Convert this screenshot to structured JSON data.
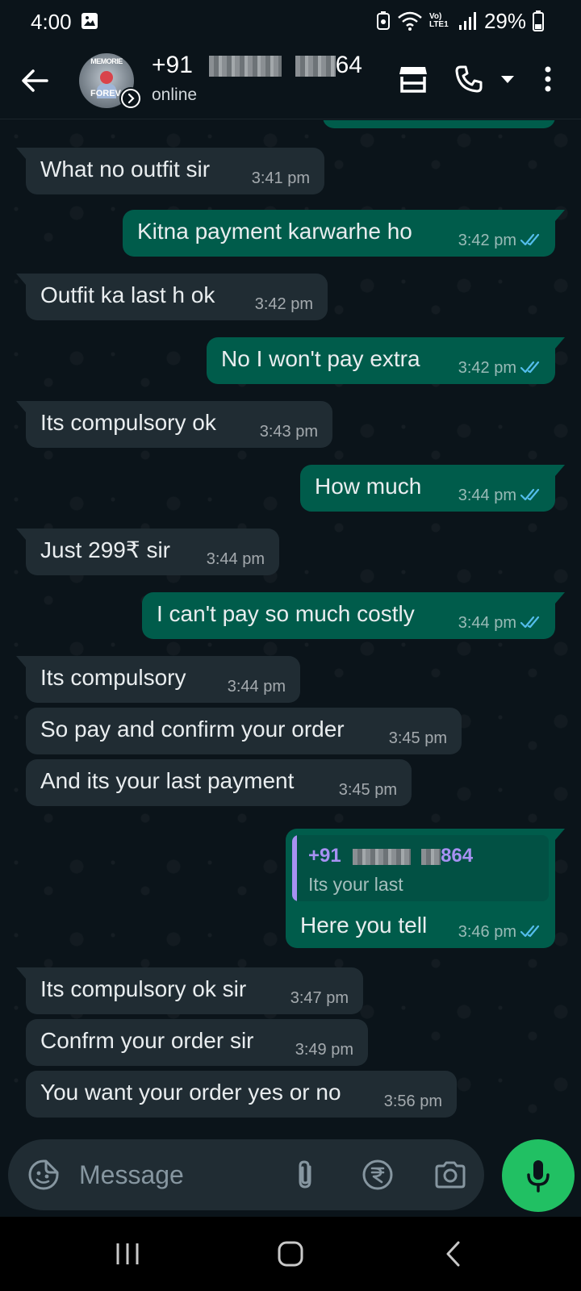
{
  "status_bar": {
    "time": "4:00",
    "network_label": "Vo) LTE1",
    "battery": "29%"
  },
  "contact": {
    "name_prefix": "+91",
    "name_suffix": "64",
    "status": "online",
    "avatar_text_top": "MEMORIE",
    "avatar_text_bottom": "FOREV"
  },
  "messages": [
    {
      "direction": "in",
      "text": "What no outfit sir",
      "time": "3:41 pm"
    },
    {
      "direction": "out",
      "text": "Kitna payment karwarhe ho",
      "time": "3:42 pm"
    },
    {
      "direction": "in",
      "text": "Outfit ka last h ok",
      "time": "3:42 pm"
    },
    {
      "direction": "out",
      "text": "No I won't pay extra",
      "time": "3:42 pm"
    },
    {
      "direction": "in",
      "text": "Its compulsory ok",
      "time": "3:43 pm"
    },
    {
      "direction": "out",
      "text": "How much",
      "time": "3:44 pm"
    },
    {
      "direction": "in",
      "text": "Just 299₹ sir",
      "time": "3:44 pm"
    },
    {
      "direction": "out",
      "text": "I can't pay so much costly",
      "time": "3:44 pm"
    },
    {
      "direction": "in",
      "text": "Its compulsory",
      "time": "3:44 pm"
    },
    {
      "direction": "in",
      "text": "So pay and confirm your order",
      "time": "3:45 pm"
    },
    {
      "direction": "in",
      "text": "And its your last payment",
      "time": "3:45 pm"
    },
    {
      "direction": "out",
      "text": "Here you tell",
      "time": "3:46 pm",
      "quote": {
        "author_prefix": "+91",
        "author_suffix": "864",
        "text": "Its your last"
      }
    },
    {
      "direction": "in",
      "text": "Its compulsory ok sir",
      "time": "3:47 pm"
    },
    {
      "direction": "in",
      "text": "Confrm your order sir",
      "time": "3:49 pm"
    },
    {
      "direction": "in",
      "text": "You want your order yes or no",
      "time": "3:56 pm"
    }
  ],
  "input": {
    "placeholder": "Message"
  },
  "icons": {
    "back": "arrow-left-icon",
    "shop": "shop-icon",
    "call": "phone-icon",
    "call_menu": "caret-down-icon",
    "more": "more-vertical-icon",
    "emoji": "sticker-icon",
    "attach": "paperclip-icon",
    "payment": "rupee-icon",
    "camera": "camera-icon",
    "mic": "mic-icon",
    "nav_recents": "recents-icon",
    "nav_home": "home-icon",
    "nav_back": "back-icon"
  },
  "colors": {
    "background": "#0b141a",
    "incoming_bubble": "#202c33",
    "outgoing_bubble": "#005c4b",
    "read_ticks": "#53bdeb",
    "mic_button": "#21c063",
    "quote_accent": "#a791f2"
  }
}
